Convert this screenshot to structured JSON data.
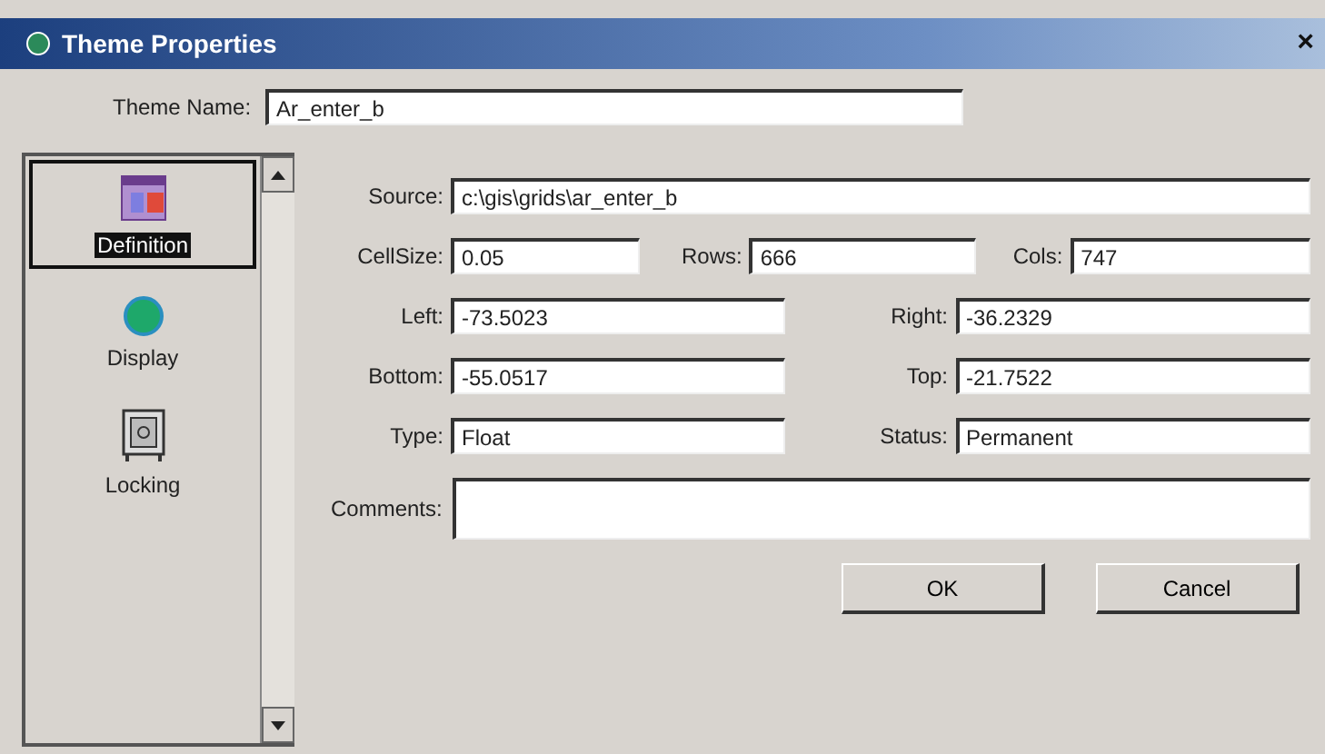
{
  "window": {
    "title": "Theme Properties",
    "close": "×"
  },
  "theme_name": {
    "label": "Theme Name:",
    "value": "Ar_enter_b"
  },
  "sidebar": {
    "items": [
      {
        "label": "Definition",
        "kind": "table",
        "selected": true
      },
      {
        "label": "Display",
        "kind": "dot",
        "selected": false
      },
      {
        "label": "Locking",
        "kind": "safe",
        "selected": false
      }
    ]
  },
  "source": {
    "label": "Source:",
    "value": "c:\\gis\\grids\\ar_enter_b"
  },
  "rows": [
    [
      {
        "label": "CellSize:",
        "value": "0.05"
      },
      {
        "label": "Rows:",
        "value": "666"
      },
      {
        "label": "Cols:",
        "value": "747"
      }
    ],
    [
      {
        "label": "Left:",
        "value": "-73.5023"
      },
      {
        "label": "Right:",
        "value": "-36.2329"
      }
    ],
    [
      {
        "label": "Bottom:",
        "value": "-55.0517"
      },
      {
        "label": "Top:",
        "value": "-21.7522"
      }
    ],
    [
      {
        "label": "Type:",
        "value": "Float"
      },
      {
        "label": "Status:",
        "value": "Permanent"
      }
    ]
  ],
  "comments": {
    "label": "Comments:"
  },
  "buttons": [
    "OK",
    "Cancel"
  ]
}
